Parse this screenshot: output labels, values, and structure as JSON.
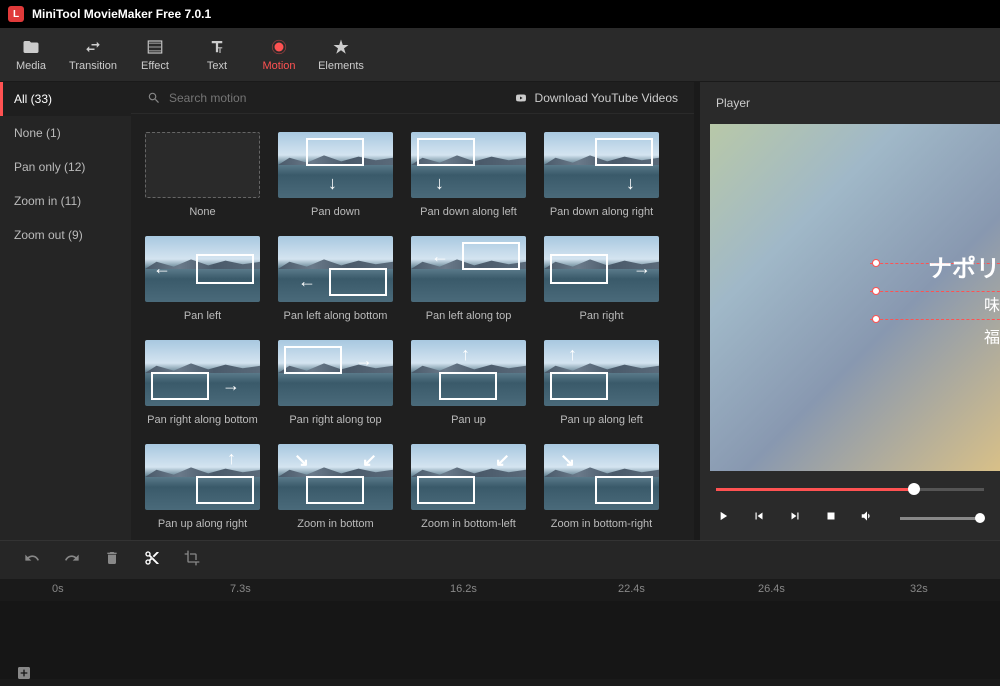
{
  "app": {
    "title": "MiniTool MovieMaker Free 7.0.1",
    "logo_letter": "L"
  },
  "toolbar": [
    {
      "id": "media",
      "label": "Media"
    },
    {
      "id": "transition",
      "label": "Transition"
    },
    {
      "id": "effect",
      "label": "Effect"
    },
    {
      "id": "text",
      "label": "Text"
    },
    {
      "id": "motion",
      "label": "Motion",
      "active": true
    },
    {
      "id": "elements",
      "label": "Elements"
    }
  ],
  "categories": [
    {
      "label": "All (33)",
      "active": true
    },
    {
      "label": "None (1)"
    },
    {
      "label": "Pan only (12)"
    },
    {
      "label": "Zoom in (11)"
    },
    {
      "label": "Zoom out (9)"
    }
  ],
  "search": {
    "placeholder": "Search motion"
  },
  "download_yt": "Download YouTube Videos",
  "motions": [
    [
      "None",
      "Pan down",
      "Pan down along left",
      "Pan down along right"
    ],
    [
      "Pan left",
      "Pan left along bottom",
      "Pan left along top",
      "Pan right"
    ],
    [
      "Pan right along bottom",
      "Pan right along top",
      "Pan up",
      "Pan up along left"
    ],
    [
      "Pan up along right",
      "Zoom in bottom",
      "Zoom in bottom-left",
      "Zoom in bottom-right"
    ]
  ],
  "player": {
    "title": "Player",
    "subtitle_line1": "ナポリ",
    "subtitle_line2": "味",
    "subtitle_line3": "福",
    "progress_pct": 74
  },
  "timeline": {
    "marks": [
      "0s",
      "7.3s",
      "16.2s",
      "22.4s",
      "26.4s",
      "32s"
    ]
  }
}
